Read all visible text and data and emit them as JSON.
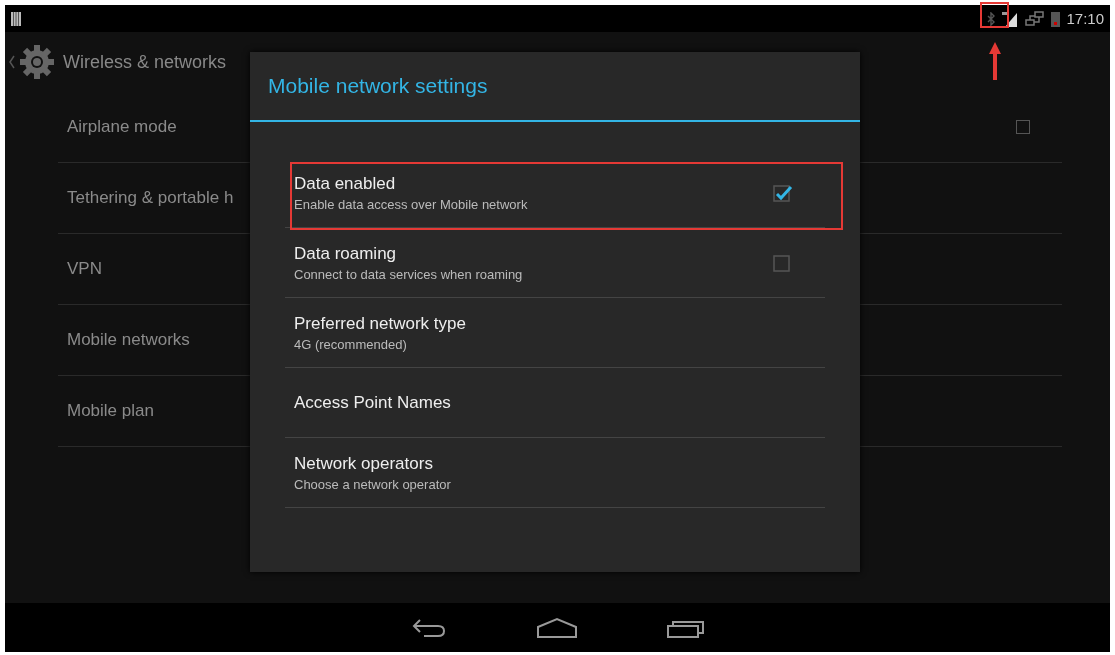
{
  "status_bar": {
    "time": "17:10"
  },
  "action_bar": {
    "title": "Wireless & networks"
  },
  "settings": [
    {
      "label": "Airplane mode",
      "kind": "checkbox",
      "checked": false
    },
    {
      "label": "Tethering & portable h",
      "kind": "plain"
    },
    {
      "label": "VPN",
      "kind": "plain"
    },
    {
      "label": "Mobile networks",
      "kind": "plain"
    },
    {
      "label": "Mobile plan",
      "kind": "plain"
    }
  ],
  "dialog": {
    "title": "Mobile network settings",
    "items": [
      {
        "title": "Data enabled",
        "summary": "Enable data access over Mobile network",
        "kind": "checkbox",
        "checked": true,
        "highlighted": true
      },
      {
        "title": "Data roaming",
        "summary": "Connect to data services when roaming",
        "kind": "checkbox",
        "checked": false,
        "highlighted": false
      },
      {
        "title": "Preferred network type",
        "summary": "4G (recommended)",
        "kind": "plain",
        "highlighted": false
      },
      {
        "title": "Access Point Names",
        "kind": "plain",
        "highlighted": false
      },
      {
        "title": "Network operators",
        "summary": "Choose a network operator",
        "kind": "plain",
        "highlighted": false
      }
    ]
  }
}
